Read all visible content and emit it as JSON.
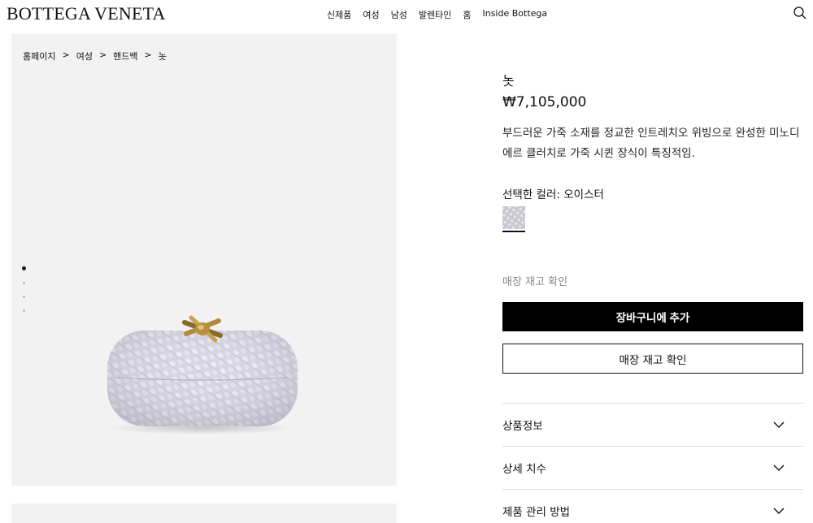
{
  "header": {
    "logo": "BOTTEGA VENETA",
    "nav": [
      "신제품",
      "여성",
      "남성",
      "발렌타인",
      "홈",
      "Inside Bottega"
    ]
  },
  "breadcrumb": [
    "홈페이지",
    "여성",
    "핸드백",
    "놋"
  ],
  "breadcrumb_sep": ">",
  "product": {
    "name": "놋",
    "price": "₩7,105,000",
    "description": "부드러운 가죽 소재를 정교한 인트레치오 위빙으로 완성한 미노디에르 클러치로 가죽 시퀸 장식이 특징적임.",
    "color_label": "선택한 컬러: 오이스터",
    "swatch_color": "#c9c7d2"
  },
  "actions": {
    "store_stock_link": "매장 재고 확인",
    "add_to_cart": "장바구니에 추가",
    "check_store": "매장 재고 확인"
  },
  "accordion": [
    "상품정보",
    "상세 치수",
    "제품 관리 방법"
  ],
  "gallery": {
    "image_count": 4,
    "active_index": 0
  }
}
